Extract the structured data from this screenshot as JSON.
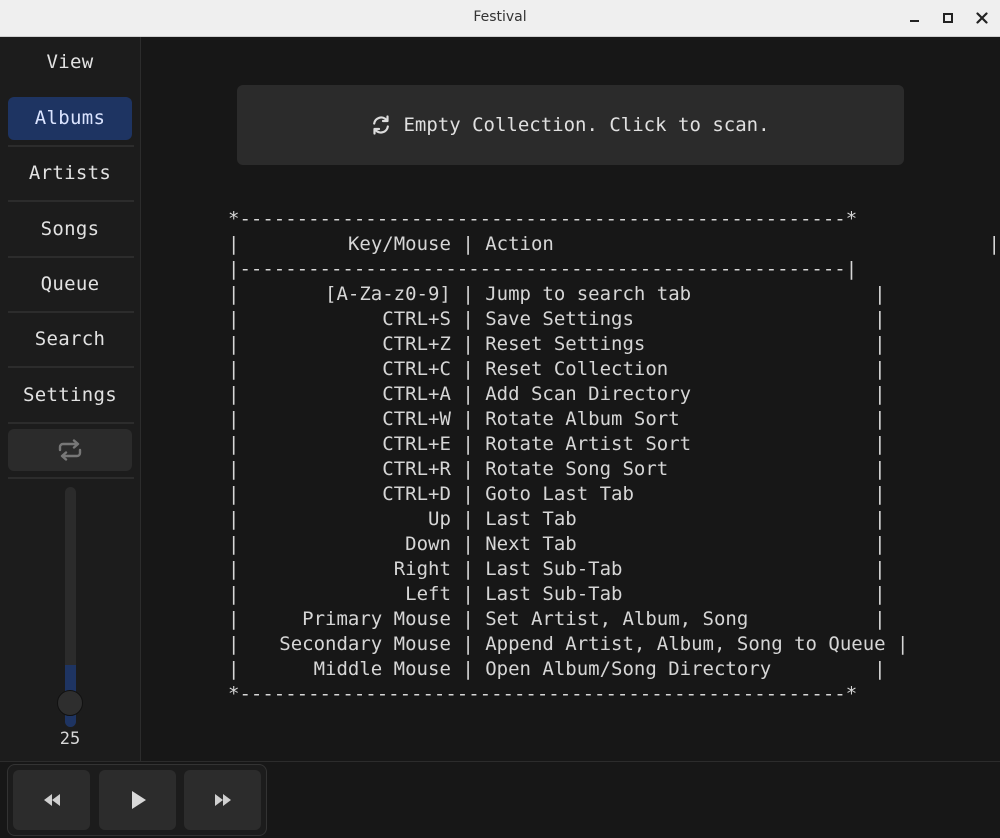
{
  "window": {
    "title": "Festival"
  },
  "sidebar": {
    "items": [
      {
        "label": "View",
        "active": false
      },
      {
        "label": "Albums",
        "active": true
      },
      {
        "label": "Artists",
        "active": false
      },
      {
        "label": "Songs",
        "active": false
      },
      {
        "label": "Queue",
        "active": false
      },
      {
        "label": "Search",
        "active": false
      },
      {
        "label": "Settings",
        "active": false
      }
    ],
    "repeat_icon": "repeat-icon",
    "volume": {
      "value": "25",
      "level_percent": 25
    }
  },
  "main": {
    "scan_button": {
      "icon": "refresh-icon",
      "label": "Empty Collection. Click to scan."
    },
    "help_table": {
      "header_key": "Key/Mouse",
      "header_action": "Action",
      "rows": [
        {
          "key": "[A-Za-z0-9]",
          "action": "Jump to search tab"
        },
        {
          "key": "CTRL+S",
          "action": "Save Settings"
        },
        {
          "key": "CTRL+Z",
          "action": "Reset Settings"
        },
        {
          "key": "CTRL+C",
          "action": "Reset Collection"
        },
        {
          "key": "CTRL+A",
          "action": "Add Scan Directory"
        },
        {
          "key": "CTRL+W",
          "action": "Rotate Album Sort"
        },
        {
          "key": "CTRL+E",
          "action": "Rotate Artist Sort"
        },
        {
          "key": "CTRL+R",
          "action": "Rotate Song Sort"
        },
        {
          "key": "CTRL+D",
          "action": "Goto Last Tab"
        },
        {
          "key": "Up",
          "action": "Last Tab"
        },
        {
          "key": "Down",
          "action": "Next Tab"
        },
        {
          "key": "Right",
          "action": "Last Sub-Tab"
        },
        {
          "key": "Left",
          "action": "Last Sub-Tab"
        },
        {
          "key": "Primary Mouse",
          "action": "Set Artist, Album, Song"
        },
        {
          "key": "Secondary Mouse",
          "action": "Append Artist, Album, Song to Queue"
        },
        {
          "key": "Middle Mouse",
          "action": "Open Album/Song Directory"
        }
      ]
    }
  },
  "playback": {
    "buttons": [
      {
        "icon": "previous-icon"
      },
      {
        "icon": "play-icon"
      },
      {
        "icon": "next-icon"
      }
    ]
  },
  "colors": {
    "background": "#171717",
    "accent": "#1e3462",
    "button": "#2b2b2b",
    "text": "#d8d8d8"
  }
}
